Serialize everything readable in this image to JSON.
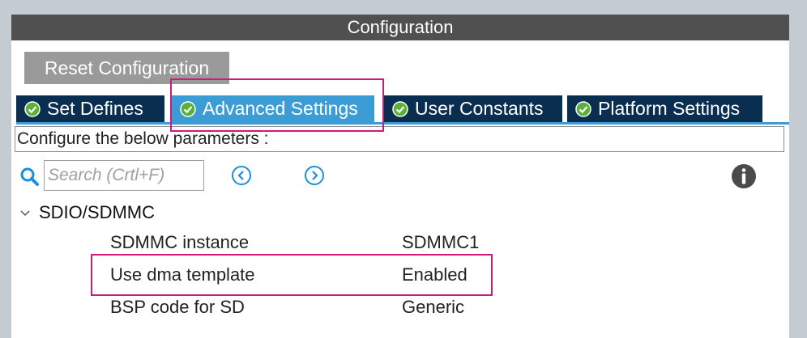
{
  "header": {
    "title": "Configuration"
  },
  "toolbar": {
    "reset_label": "Reset Configuration"
  },
  "tabs": [
    {
      "label": "Set Defines",
      "active": false
    },
    {
      "label": "Advanced Settings",
      "active": true
    },
    {
      "label": "User Constants",
      "active": false
    },
    {
      "label": "Platform Settings",
      "active": false
    }
  ],
  "hint": "Configure the below parameters :",
  "search": {
    "placeholder": "Search (Crtl+F)",
    "value": ""
  },
  "group": {
    "label": "SDIO/SDMMC",
    "expanded": true
  },
  "params": [
    {
      "name": "SDMMC instance",
      "value": "SDMMC1"
    },
    {
      "name": "Use dma template",
      "value": "Enabled"
    },
    {
      "name": "BSP code for SD",
      "value": "Generic"
    }
  ],
  "colors": {
    "title_bar": "#505050",
    "tab_bg": "#092e4f",
    "tab_active": "#3c9dd6",
    "check_badge": "#59b13a",
    "highlight": "#d0197c",
    "nav_blue": "#1a8ee0"
  },
  "icons": [
    "check-circle-icon",
    "search-icon",
    "prev-icon",
    "next-icon",
    "info-icon",
    "chevron-down-icon"
  ]
}
